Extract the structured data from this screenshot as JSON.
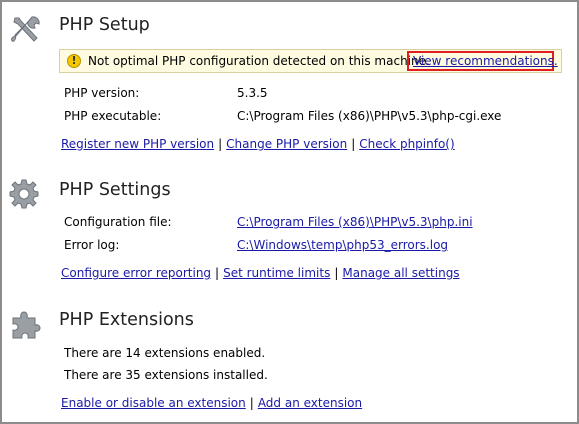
{
  "setup": {
    "title": "PHP Setup",
    "warning_text": "Not optimal PHP configuration detected on this machine.",
    "warning_link": "View recommendations.",
    "version_label": "PHP version:",
    "version_value": "5.3.5",
    "executable_label": "PHP executable:",
    "executable_value": "C:\\Program Files (x86)\\PHP\\v5.3\\php-cgi.exe",
    "links": [
      "Register new PHP version",
      "Change PHP version",
      "Check phpinfo()"
    ]
  },
  "settings": {
    "title": "PHP Settings",
    "config_label": "Configuration file:",
    "config_value": "C:\\Program Files (x86)\\PHP\\v5.3\\php.ini",
    "errorlog_label": "Error log:",
    "errorlog_value": "C:\\Windows\\temp\\php53_errors.log",
    "links": [
      "Configure error reporting",
      "Set runtime limits",
      "Manage all settings"
    ]
  },
  "extensions": {
    "title": "PHP Extensions",
    "enabled_text": "There are 14 extensions enabled.",
    "installed_text": "There are 35 extensions installed.",
    "links": [
      "Enable or disable an extension",
      "Add an extension"
    ]
  },
  "separator": "|",
  "icons": {
    "setup": "tools-icon",
    "settings": "gear-icon",
    "extensions": "puzzle-icon",
    "warning": "warning-icon"
  },
  "colors": {
    "link": "#1a1aa6",
    "highlight_box": "#e02020",
    "warning_bg": "#fffbe0"
  }
}
